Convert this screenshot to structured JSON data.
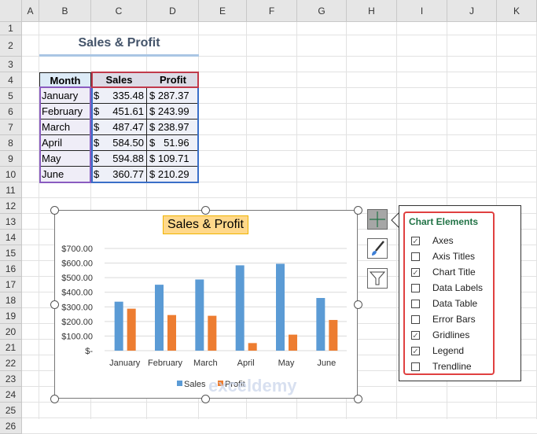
{
  "columns": [
    "A",
    "B",
    "C",
    "D",
    "E",
    "F",
    "G",
    "H",
    "I",
    "J",
    "K"
  ],
  "rows": [
    "1",
    "2",
    "3",
    "4",
    "5",
    "6",
    "7",
    "8",
    "9",
    "10",
    "11",
    "12",
    "13",
    "14",
    "15",
    "16",
    "17",
    "18",
    "19",
    "20",
    "21",
    "22",
    "23",
    "24",
    "25",
    "26"
  ],
  "sheet_title": "Sales & Profit",
  "table": {
    "headers": [
      "Month",
      "Sales",
      "Profit"
    ],
    "rows": [
      [
        "January",
        "$",
        "335.48",
        "$ 287.37"
      ],
      [
        "February",
        "$",
        "451.61",
        "$ 243.99"
      ],
      [
        "March",
        "$",
        "487.47",
        "$ 238.97"
      ],
      [
        "April",
        "$",
        "584.50",
        "$   51.96"
      ],
      [
        "May",
        "$",
        "594.88",
        "$ 109.71"
      ],
      [
        "June",
        "$",
        "360.77",
        "$ 210.29"
      ]
    ]
  },
  "chart_data": {
    "type": "bar",
    "title": "Sales & Profit",
    "categories": [
      "January",
      "February",
      "March",
      "April",
      "May",
      "June"
    ],
    "series": [
      {
        "name": "Sales",
        "color": "#5b9bd5",
        "values": [
          335.48,
          451.61,
          487.47,
          584.5,
          594.88,
          360.77
        ]
      },
      {
        "name": "Profit",
        "color": "#ed7d31",
        "values": [
          287.37,
          243.99,
          238.97,
          51.96,
          109.71,
          210.29
        ]
      }
    ],
    "ylim": [
      0,
      700
    ],
    "yticks": [
      "$-",
      "$100.00",
      "$200.00",
      "$300.00",
      "$400.00",
      "$500.00",
      "$600.00",
      "$700.00"
    ],
    "grid": true,
    "legend": "bottom"
  },
  "side_buttons": [
    {
      "icon": "plus-icon"
    },
    {
      "icon": "brush-icon"
    },
    {
      "icon": "filter-icon"
    }
  ],
  "chart_elements": {
    "title": "Chart Elements",
    "items": [
      {
        "label": "Axes",
        "checked": true
      },
      {
        "label": "Axis Titles",
        "checked": false
      },
      {
        "label": "Chart Title",
        "checked": true
      },
      {
        "label": "Data Labels",
        "checked": false
      },
      {
        "label": "Data Table",
        "checked": false
      },
      {
        "label": "Error Bars",
        "checked": false
      },
      {
        "label": "Gridlines",
        "checked": true
      },
      {
        "label": "Legend",
        "checked": true
      },
      {
        "label": "Trendline",
        "checked": false
      }
    ]
  },
  "watermark": {
    "name": "exceldemy",
    "tagline": "EXCEL · DATA · BI"
  }
}
